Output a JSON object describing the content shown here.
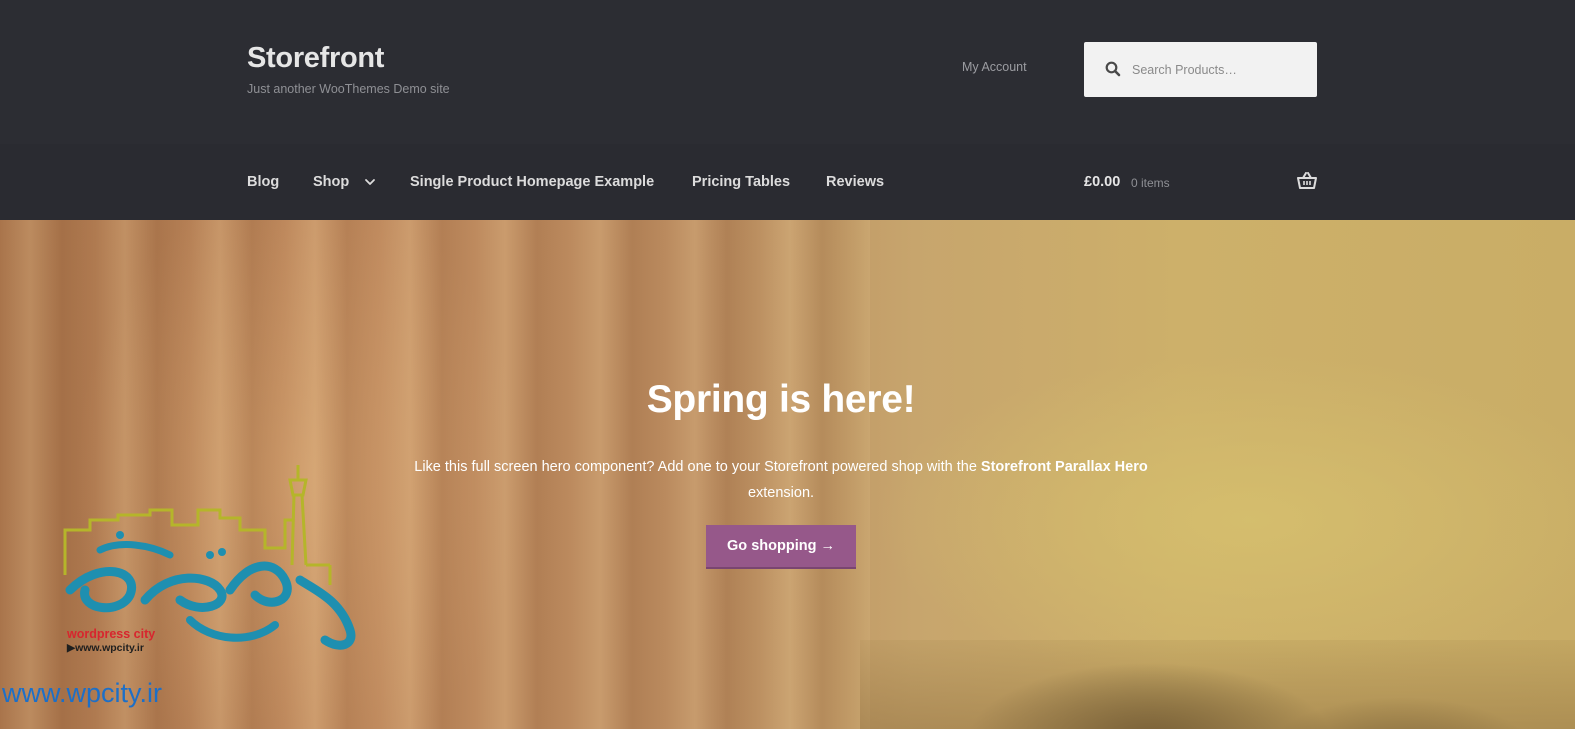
{
  "header": {
    "site_title": "Storefront",
    "tagline": "Just another WooThemes Demo site",
    "account_link": "My Account",
    "search_placeholder": "Search Products…"
  },
  "nav": {
    "items": [
      {
        "label": "Blog"
      },
      {
        "label": "Shop",
        "has_dropdown": true
      },
      {
        "label": "Single Product Homepage Example"
      },
      {
        "label": "Pricing Tables"
      },
      {
        "label": "Reviews"
      }
    ],
    "dropdown_icon": "chevron-down-icon"
  },
  "cart": {
    "total": "£0.00",
    "count": "0 items",
    "icon": "basket-icon"
  },
  "hero": {
    "title": "Spring is here!",
    "text_before": "Like this full screen hero component? Add one to your Storefront powered shop with the ",
    "text_strong": "Storefront Parallax Hero",
    "text_after": " extension.",
    "button_label": "Go shopping →"
  },
  "watermark": {
    "name": "wordpress city",
    "url_small": "▶www.wpcity.ir",
    "url": "www.wpcity.ir"
  },
  "colors": {
    "header_bg": "#2c2d33",
    "accent": "#96588a",
    "watermark_teal": "#1e8fb0",
    "watermark_olive": "#b5b52a"
  }
}
